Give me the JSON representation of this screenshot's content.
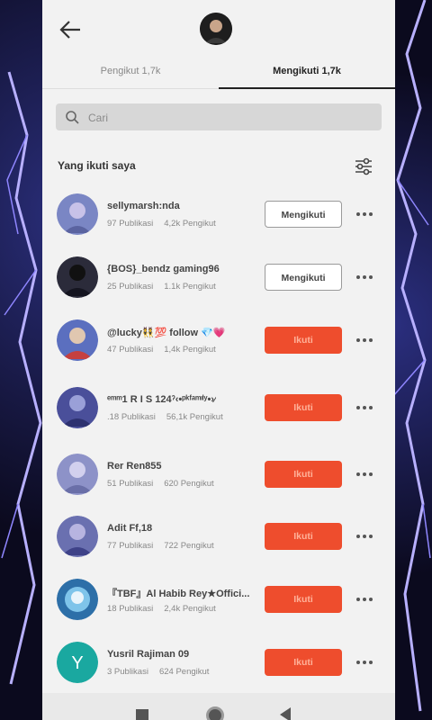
{
  "tabs": [
    {
      "label": "Pengikut 1,7k"
    },
    {
      "label": "Mengikuti 1,7k"
    }
  ],
  "search": {
    "placeholder": "Cari"
  },
  "section": {
    "title": "Yang ikuti saya"
  },
  "users": [
    {
      "name": "sellymarsh:nda",
      "posts": "97 Publikasi",
      "followers": "4,2k Pengikut",
      "button": "Mengikuti",
      "state": "following",
      "avatar_color": "#7a86c4"
    },
    {
      "name": "{BOS}_bendz gaming96",
      "posts": "25 Publikasi",
      "followers": "1.1k Pengikut",
      "button": "Mengikuti",
      "state": "following",
      "avatar_color": "#2b2b3a"
    },
    {
      "name": "@lucky👯💯 follow 💎💗",
      "posts": "47 Publikasi",
      "followers": "1,4k Pengikut",
      "button": "Ikuti",
      "state": "follow",
      "avatar_color": "#5b6fbf"
    },
    {
      "name": "ᵉᵐᵐ1 R I S 124ˀ‹•ᵖᵏᶠᵃᵐᶦˡʸ•›⁄",
      "posts": ".18 Publikasi",
      "followers": "56,1k Pengikut",
      "button": "Ikuti",
      "state": "follow",
      "avatar_color": "#4a4f9a"
    },
    {
      "name": "Rer  Ren855",
      "posts": "51 Publikasi",
      "followers": "620 Pengikut",
      "button": "Ikuti",
      "state": "follow",
      "avatar_color": "#8d92c8"
    },
    {
      "name": "Adit Ff,18",
      "posts": "77 Publikasi",
      "followers": "722 Pengikut",
      "button": "Ikuti",
      "state": "follow",
      "avatar_color": "#6a70b0"
    },
    {
      "name": "『TBF』Al Habib Rey★Offici...",
      "posts": "18 Publikasi",
      "followers": "2,4k Pengikut",
      "button": "Ikuti",
      "state": "follow",
      "avatar_color": "#2d6fa8"
    },
    {
      "name": "Yusril Rajiman 09",
      "posts": "3 Publikasi",
      "followers": "624 Pengikut",
      "button": "Ikuti",
      "state": "follow",
      "avatar_color": "#1aa8a0",
      "initial": "Y"
    }
  ],
  "colors": {
    "accent": "#ee4d2d",
    "lightning": "#b8b0ff"
  }
}
